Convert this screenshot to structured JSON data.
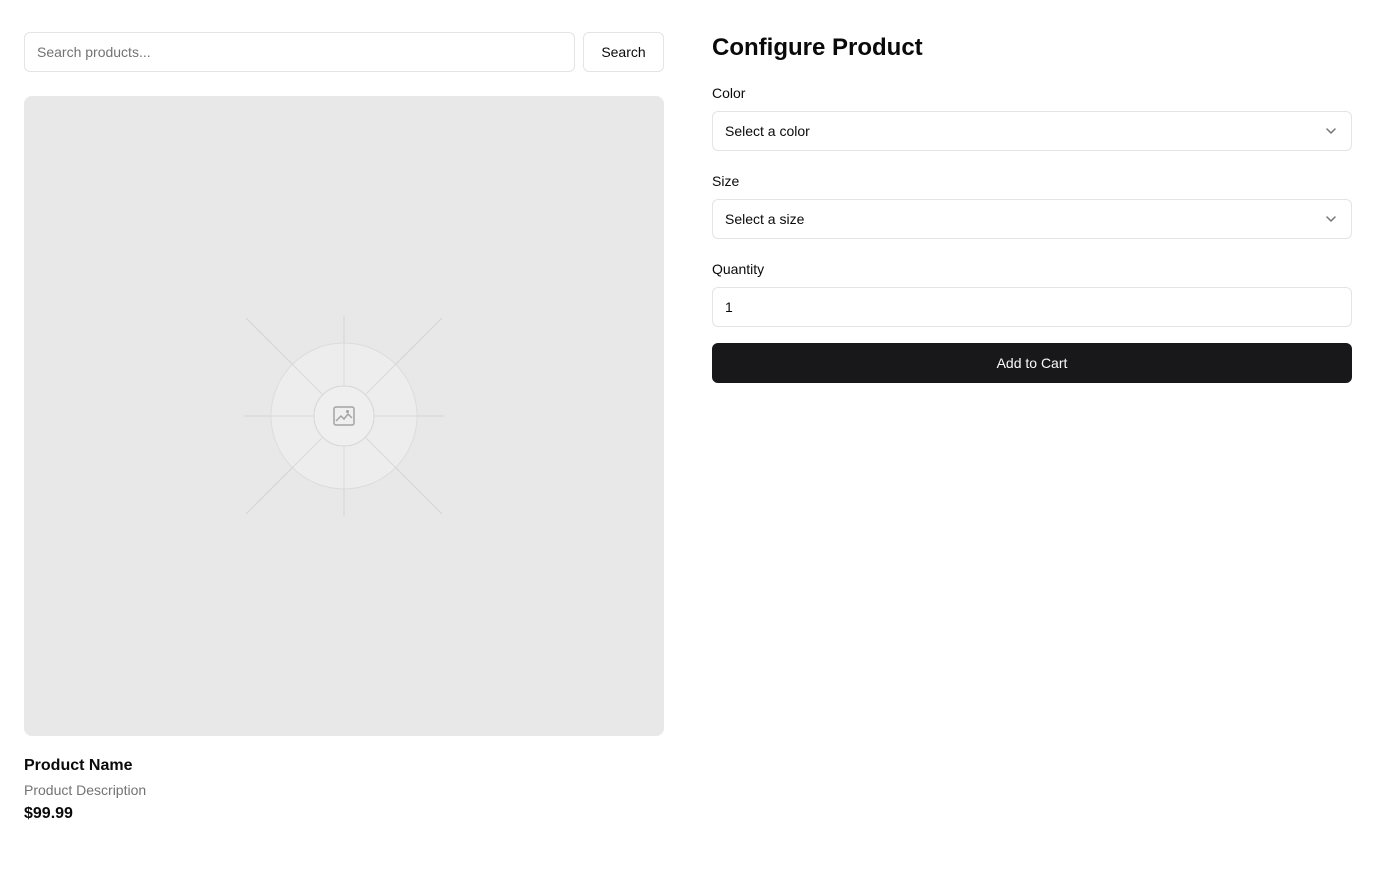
{
  "search": {
    "placeholder": "Search products...",
    "button_label": "Search"
  },
  "product": {
    "image_icon": "image-placeholder-icon",
    "name": "Product Name",
    "description": "Product Description",
    "price": "$99.99"
  },
  "configure": {
    "title": "Configure Product",
    "color_label": "Color",
    "color_value": "Select a color",
    "size_label": "Size",
    "size_value": "Select a size",
    "quantity_label": "Quantity",
    "quantity_value": "1",
    "add_button_label": "Add to Cart"
  },
  "colors": {
    "accent": "#18181b",
    "muted_text": "#737373",
    "border": "#e4e4e7",
    "image_bg": "#e8e8e8"
  }
}
